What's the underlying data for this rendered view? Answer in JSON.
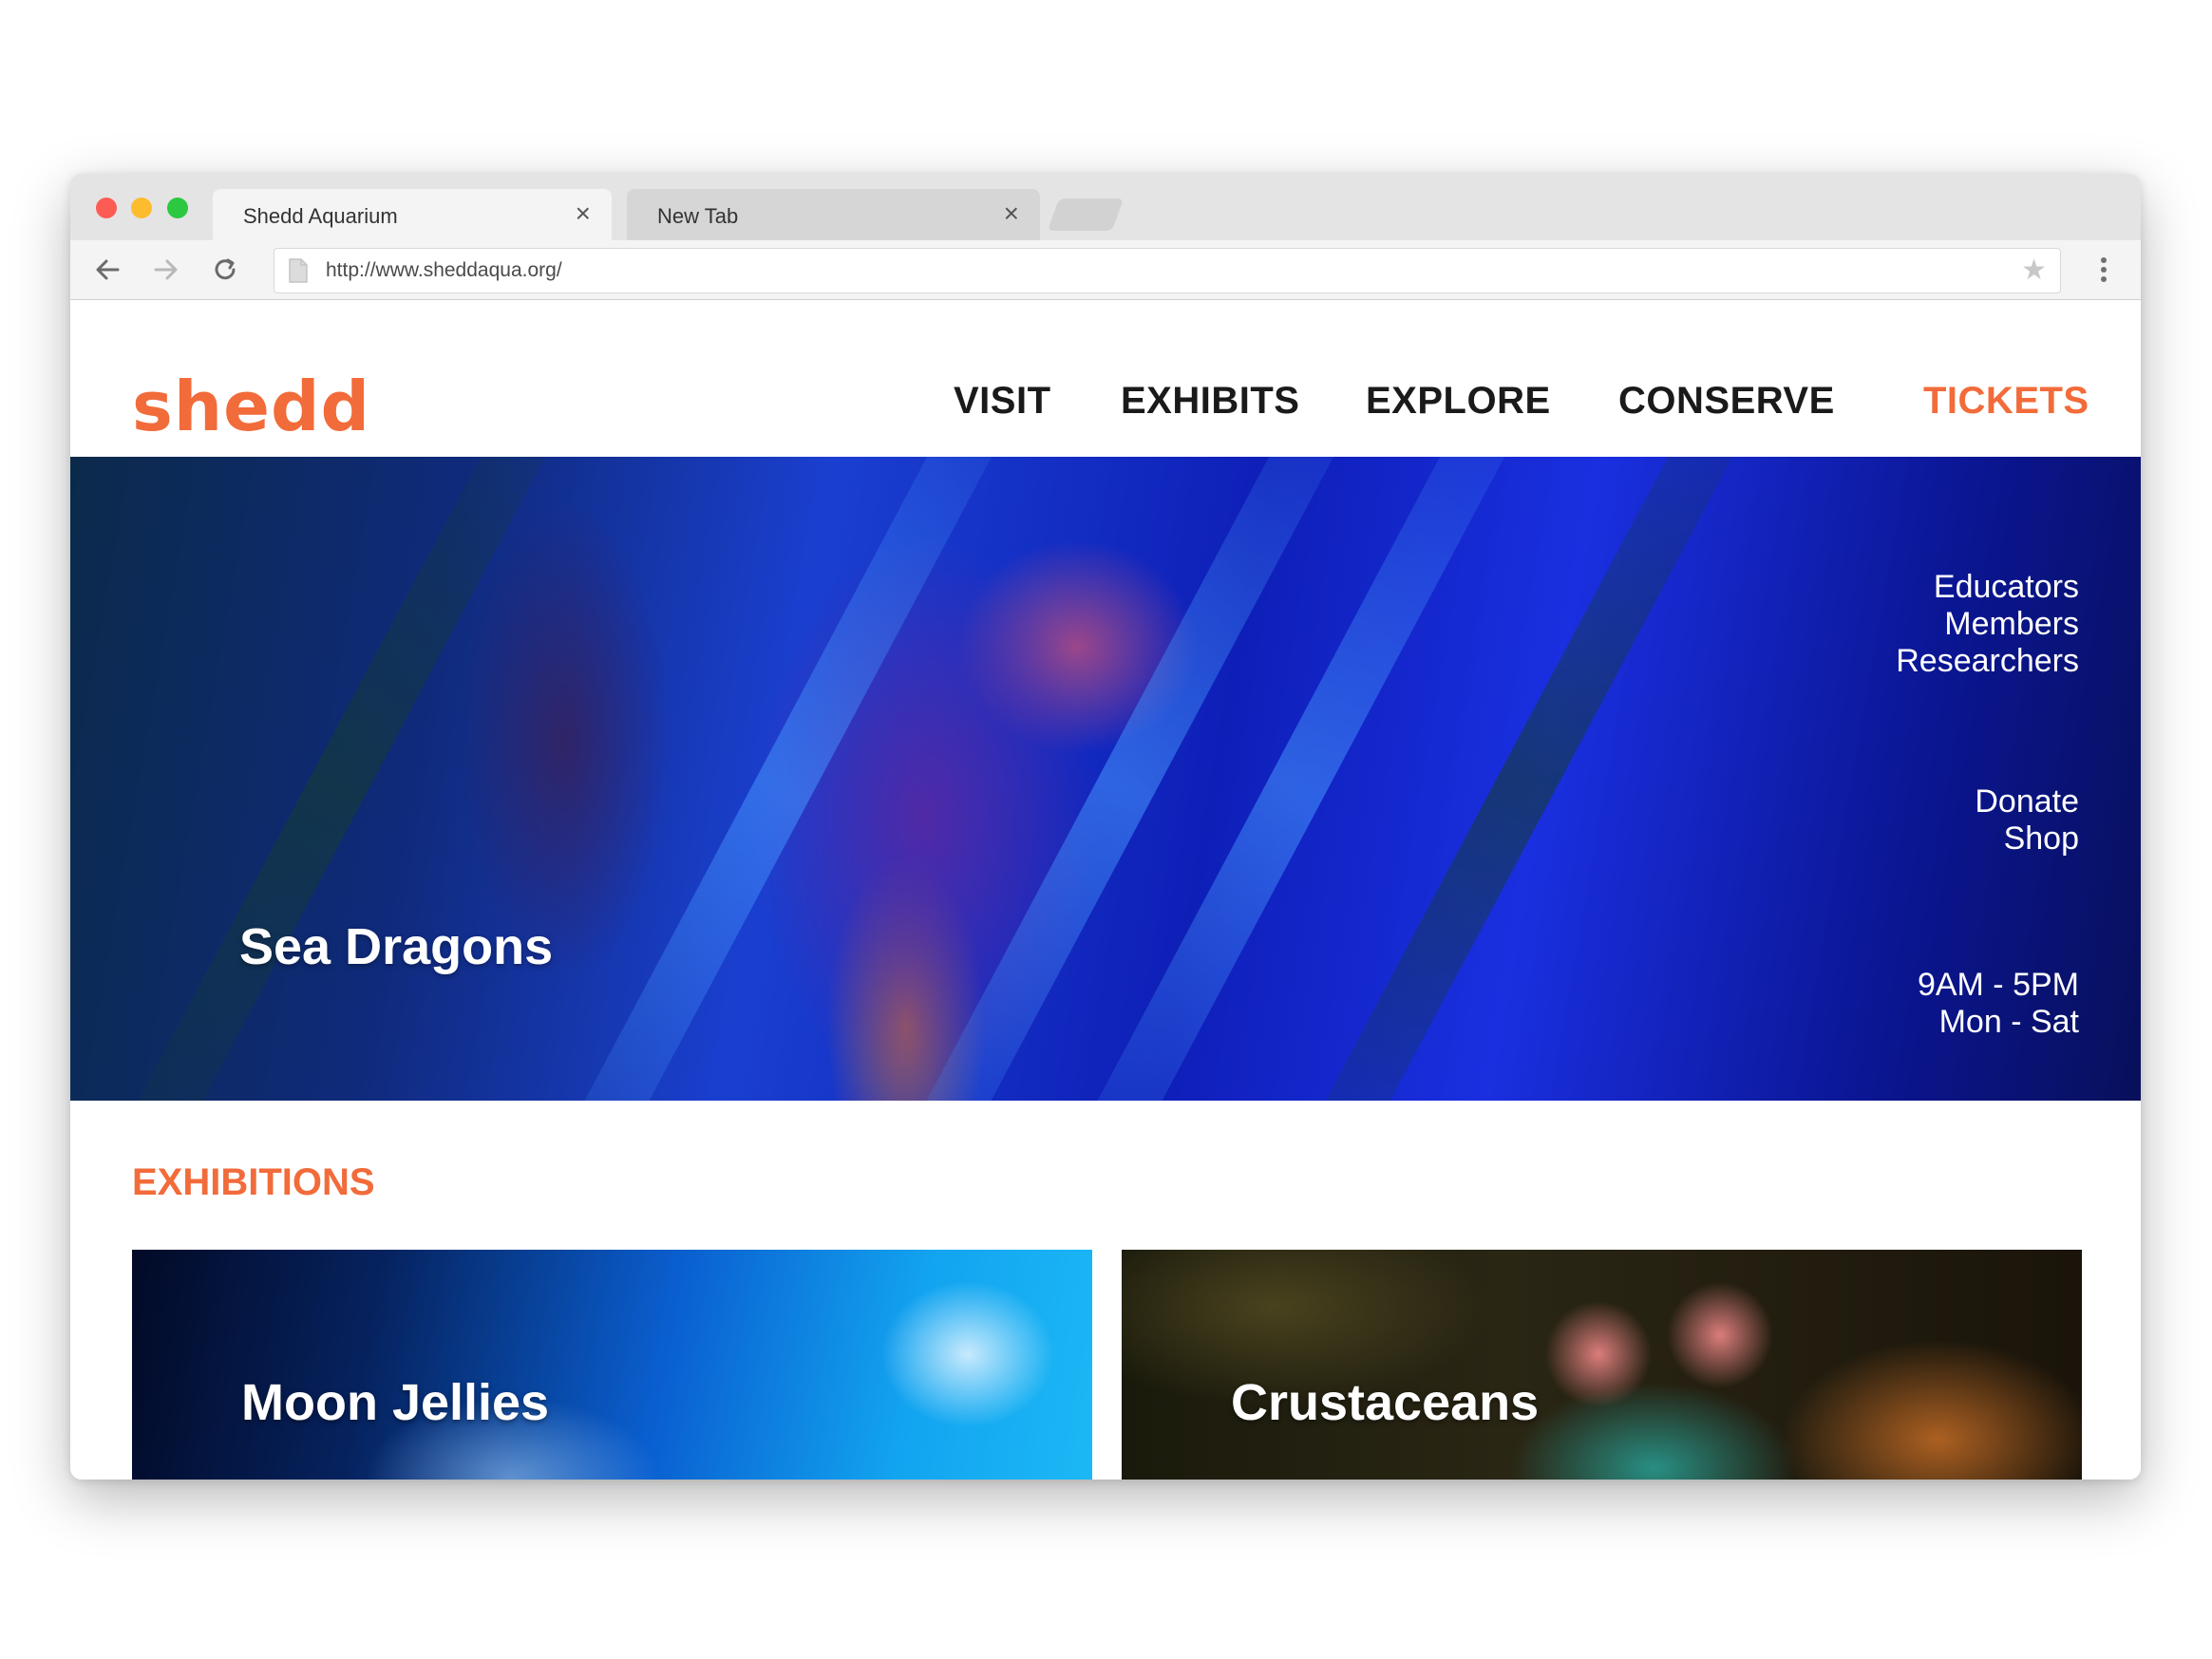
{
  "browser": {
    "tabs": [
      {
        "title": "Shedd Aquarium",
        "close": "×",
        "active": true
      },
      {
        "title": "New Tab",
        "close": "×",
        "active": false
      }
    ],
    "url": "http://www.sheddaqua.org/",
    "icons": {
      "back": "arrow-left-icon",
      "forward": "arrow-right-icon",
      "reload": "reload-icon",
      "page": "page-icon",
      "bookmark": "star-icon",
      "menu": "more-vertical-icon"
    }
  },
  "site": {
    "logo": "shedd",
    "nav": [
      "VISIT",
      "EXHIBITS",
      "EXPLORE",
      "CONSERVE",
      "TICKETS"
    ],
    "hero": {
      "title": "Sea Dragons",
      "links_group_1": [
        "Educators",
        "Members",
        "Researchers"
      ],
      "links_group_2": [
        "Donate",
        "Shop"
      ],
      "hours": [
        "9AM - 5PM",
        "Mon - Sat"
      ]
    },
    "exhibitions": {
      "title": "EXHIBITIONS",
      "cards": [
        {
          "title": "Moon Jellies"
        },
        {
          "title": "Crustaceans"
        }
      ]
    }
  },
  "colors": {
    "accent": "#f26b3a",
    "nav_text": "#1a1a1a",
    "hero_text": "#ffffff"
  }
}
